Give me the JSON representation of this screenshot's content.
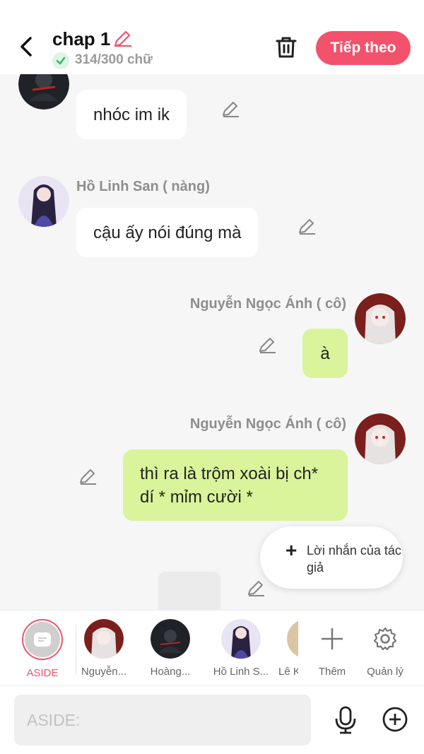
{
  "header": {
    "title": "chap 1",
    "word_count": "314/300 chữ",
    "next_label": "Tiếp theo",
    "accent": "#f2526b"
  },
  "messages": [
    {
      "speaker": "",
      "text": "nhóc im ik",
      "side": "left",
      "color": "#ffffff"
    },
    {
      "speaker": "Hồ Linh San ( nàng)",
      "text": "cậu ấy nói đúng mà",
      "side": "left",
      "color": "#ffffff"
    },
    {
      "speaker": "Nguyễn Ngọc Ánh ( cô)",
      "text": "à",
      "side": "right",
      "color": "#d9f49a"
    },
    {
      "speaker": "Nguyễn Ngọc Ánh ( cô)",
      "text": "thì ra là trộm xoài bị ch* dí * mỉm cười *",
      "side": "right",
      "color": "#d9f49a"
    }
  ],
  "author_note": {
    "label": "Lời nhắn của tác giả"
  },
  "aside_block": {
    "text": "___"
  },
  "characters": [
    {
      "label": "ASIDE",
      "active": true
    },
    {
      "label": "Nguyễn..."
    },
    {
      "label": "Hoàng..."
    },
    {
      "label": "Hồ Linh S..."
    },
    {
      "label": "Lê K"
    },
    {
      "label": "Thêm",
      "icon": "plus-icon"
    },
    {
      "label": "Quản lý",
      "icon": "gear-icon"
    }
  ],
  "input": {
    "placeholder": "ASIDE:"
  }
}
